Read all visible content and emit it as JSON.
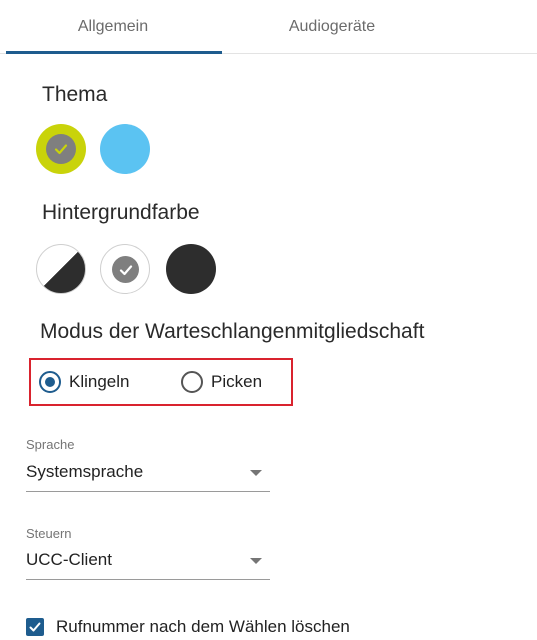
{
  "tabs": [
    {
      "label": "Allgemein",
      "active": true
    },
    {
      "label": "Audiogeräte",
      "active": false
    }
  ],
  "colors": {
    "accent": "#1e5c8e",
    "theme_lime": "#c9d30a",
    "theme_blue": "#5bc3f2",
    "dark": "#2d2d2d",
    "highlight_border": "#d9232e"
  },
  "theme": {
    "title": "Thema",
    "options": [
      "lime",
      "blue"
    ],
    "selected": "lime"
  },
  "background": {
    "title": "Hintergrundfarbe",
    "options": [
      "auto",
      "light",
      "dark"
    ],
    "selected": "light"
  },
  "queue_mode": {
    "title": "Modus der Warteschlangenmitgliedschaft",
    "options": [
      {
        "label": "Klingeln",
        "checked": true
      },
      {
        "label": "Picken",
        "checked": false
      }
    ]
  },
  "language": {
    "label": "Sprache",
    "value": "Systemsprache"
  },
  "control": {
    "label": "Steuern",
    "value": "UCC-Client"
  },
  "clear_number": {
    "label": "Rufnummer nach dem Wählen löschen",
    "checked": true
  }
}
